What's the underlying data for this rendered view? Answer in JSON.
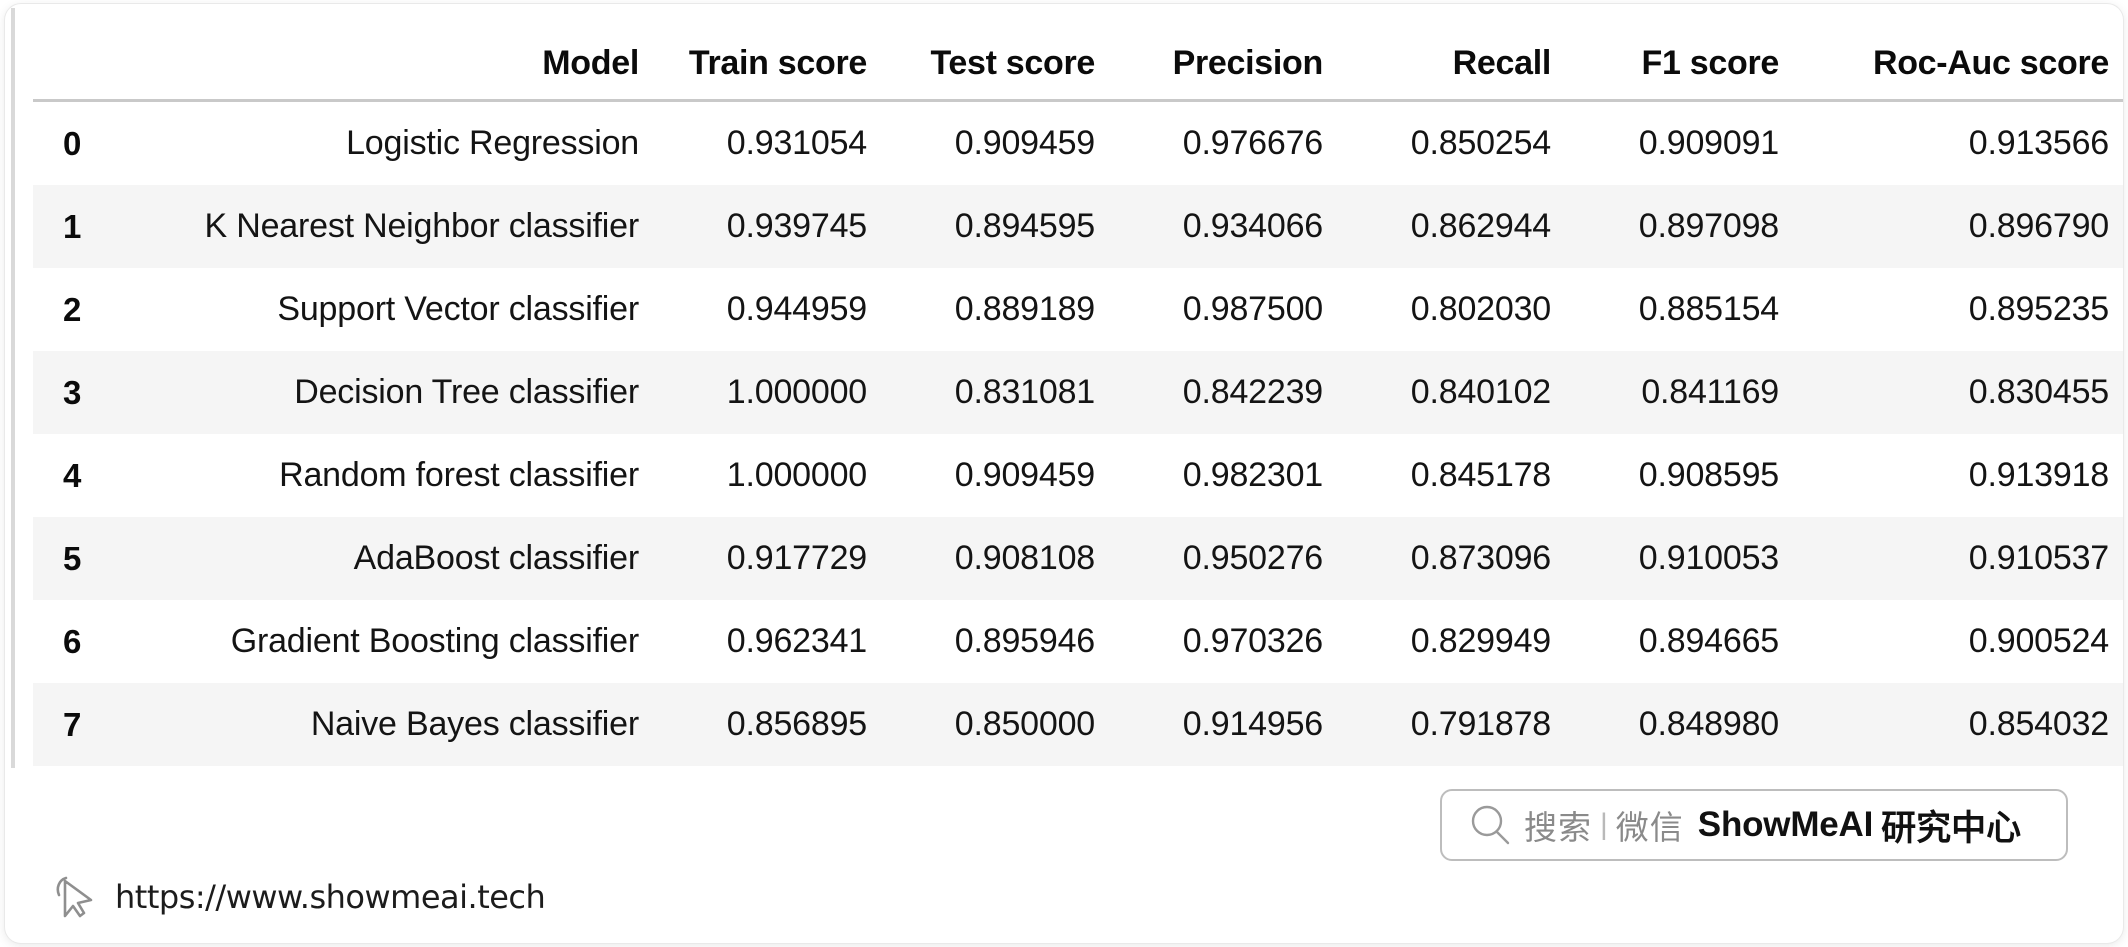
{
  "table": {
    "index_header": "",
    "columns": [
      "Model",
      "Train score",
      "Test score",
      "Precision",
      "Recall",
      "F1 score",
      "Roc-Auc score"
    ],
    "rows": [
      {
        "index": "0",
        "model": "Logistic Regression",
        "train_score": "0.931054",
        "test_score": "0.909459",
        "precision": "0.976676",
        "recall": "0.850254",
        "f1_score": "0.909091",
        "roc_auc_score": "0.913566"
      },
      {
        "index": "1",
        "model": "K Nearest Neighbor classifier",
        "train_score": "0.939745",
        "test_score": "0.894595",
        "precision": "0.934066",
        "recall": "0.862944",
        "f1_score": "0.897098",
        "roc_auc_score": "0.896790"
      },
      {
        "index": "2",
        "model": "Support Vector classifier",
        "train_score": "0.944959",
        "test_score": "0.889189",
        "precision": "0.987500",
        "recall": "0.802030",
        "f1_score": "0.885154",
        "roc_auc_score": "0.895235"
      },
      {
        "index": "3",
        "model": "Decision Tree classifier",
        "train_score": "1.000000",
        "test_score": "0.831081",
        "precision": "0.842239",
        "recall": "0.840102",
        "f1_score": "0.841169",
        "roc_auc_score": "0.830455"
      },
      {
        "index": "4",
        "model": "Random forest classifier",
        "train_score": "1.000000",
        "test_score": "0.909459",
        "precision": "0.982301",
        "recall": "0.845178",
        "f1_score": "0.908595",
        "roc_auc_score": "0.913918"
      },
      {
        "index": "5",
        "model": "AdaBoost classifier",
        "train_score": "0.917729",
        "test_score": "0.908108",
        "precision": "0.950276",
        "recall": "0.873096",
        "f1_score": "0.910053",
        "roc_auc_score": "0.910537"
      },
      {
        "index": "6",
        "model": "Gradient Boosting classifier",
        "train_score": "0.962341",
        "test_score": "0.895946",
        "precision": "0.970326",
        "recall": "0.829949",
        "f1_score": "0.894665",
        "roc_auc_score": "0.900524"
      },
      {
        "index": "7",
        "model": "Naive Bayes classifier",
        "train_score": "0.856895",
        "test_score": "0.850000",
        "precision": "0.914956",
        "recall": "0.791878",
        "f1_score": "0.848980",
        "roc_auc_score": "0.854032"
      }
    ]
  },
  "watermark": {
    "search_label": "搜索",
    "divider": "|",
    "channel": "微信",
    "brand": "ShowMeAI",
    "brand_cn": "研究中心"
  },
  "footer": {
    "url": "https://www.showmeai.tech"
  },
  "colors": {
    "stripe": "#f5f5f5",
    "header_rule": "#c9c9c9",
    "text": "#0f0f0f",
    "muted": "#8a8a8a"
  }
}
